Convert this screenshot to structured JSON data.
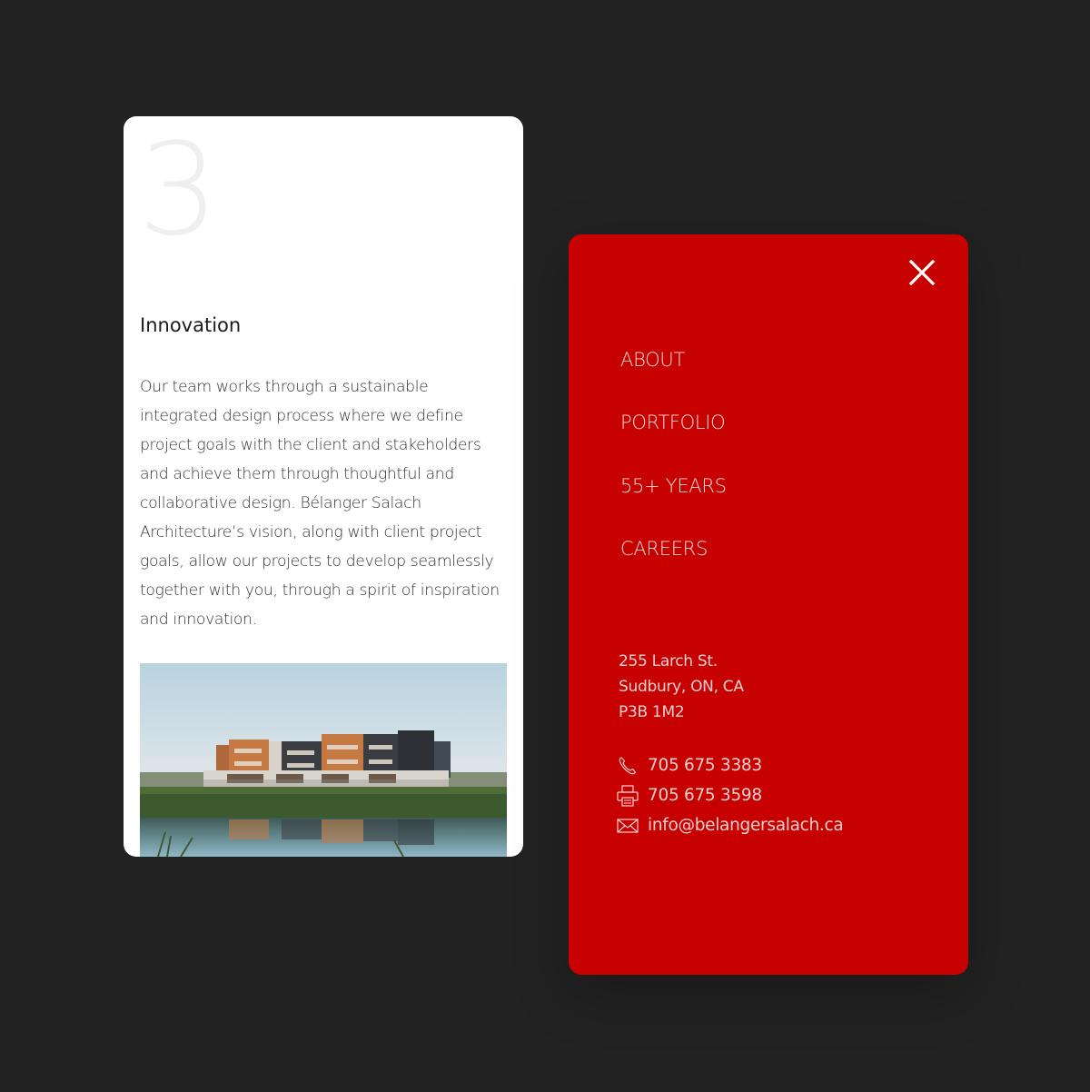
{
  "background_color": "#222222",
  "info_card": {
    "step_number": "3",
    "title": "Innovation",
    "body": "Our team works through a sustainable integrated design process where we define project goals with the client and stakeholders and achieve them through thoughtful and collaborative design. Bélanger Salach Architecture’s vision, along with client project goals, allow our projects to develop seamlessly together with you, through a spirit of inspiration and innovation.",
    "image": {
      "description": "Modern three-storey building with orange and grey facade reflected in a pond with reeds at dusk"
    }
  },
  "menu_card": {
    "accent_color": "#c70000",
    "close_icon": "close-icon",
    "nav_items": [
      {
        "label": "ABOUT"
      },
      {
        "label": "PORTFOLIO"
      },
      {
        "label": "55+ YEARS"
      },
      {
        "label": "CAREERS"
      }
    ],
    "address": {
      "line1": "255 Larch St.",
      "line2": "Sudbury, ON, CA",
      "line3": "P3B 1M2"
    },
    "contacts": [
      {
        "icon": "phone-icon",
        "value": "705 675 3383"
      },
      {
        "icon": "fax-icon",
        "value": "705 675 3598"
      },
      {
        "icon": "mail-icon",
        "value": "info@belangersalach.ca"
      }
    ]
  }
}
